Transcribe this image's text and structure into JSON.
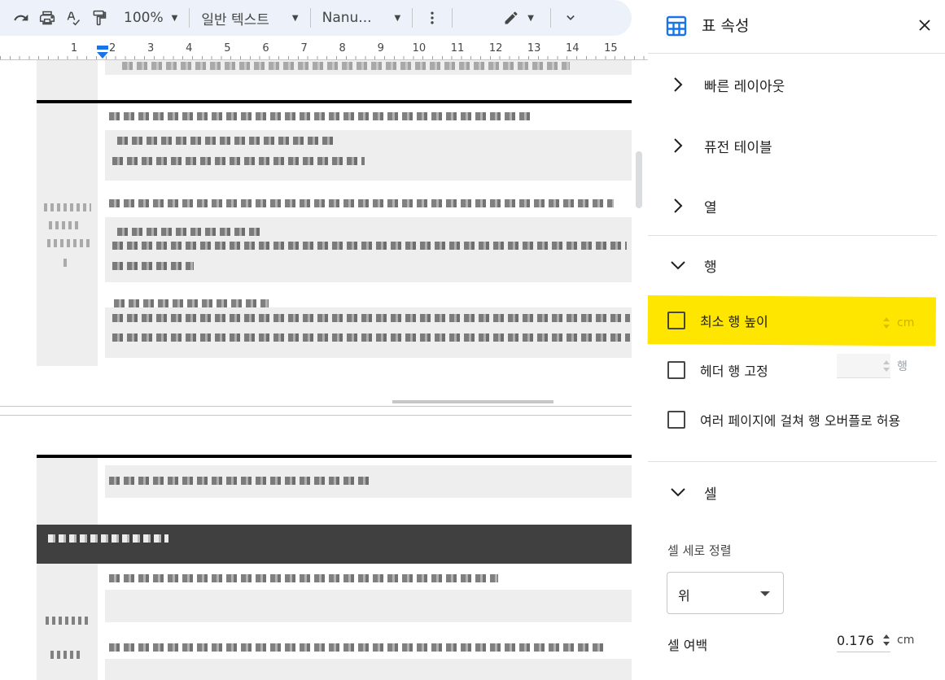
{
  "toolbar": {
    "zoom": "100%",
    "style": "일반 텍스트",
    "font": "Nanu...",
    "icons": [
      "redo-icon",
      "print-icon",
      "spellcheck-icon",
      "paint-format-icon",
      "more-icon",
      "edit-mode-icon",
      "collapse-icon"
    ]
  },
  "ruler": {
    "numbers": [
      "1",
      "2",
      "3",
      "4",
      "5",
      "6",
      "7",
      "8",
      "9",
      "10",
      "11",
      "12",
      "13",
      "14",
      "15"
    ]
  },
  "panel": {
    "title": "표 속성",
    "sections": {
      "quick_layout": "빠른 레이아웃",
      "fusion_table": "퓨전 테이블",
      "column": "열",
      "row": "행",
      "cell": "셀"
    },
    "row_options": {
      "min_row_height": {
        "label": "최소 행 높이",
        "checked": false,
        "value": "",
        "unit": "cm"
      },
      "pin_header_rows": {
        "label": "헤더 행 고정",
        "checked": false,
        "value": "",
        "unit": "행"
      },
      "allow_overflow": {
        "label": "여러 페이지에 걸쳐 행 오버플로 허용",
        "checked": false
      }
    },
    "cell_options": {
      "vertical_align_label": "셀 세로 정렬",
      "vertical_align_value": "위",
      "padding_label": "셀 여백",
      "padding_value": "0.176",
      "padding_unit": "cm"
    }
  },
  "colors": {
    "accent": "#1a73e8",
    "highlight": "#ffe600",
    "toolbar_bg": "#edf2fa",
    "dark_row": "#404040"
  }
}
